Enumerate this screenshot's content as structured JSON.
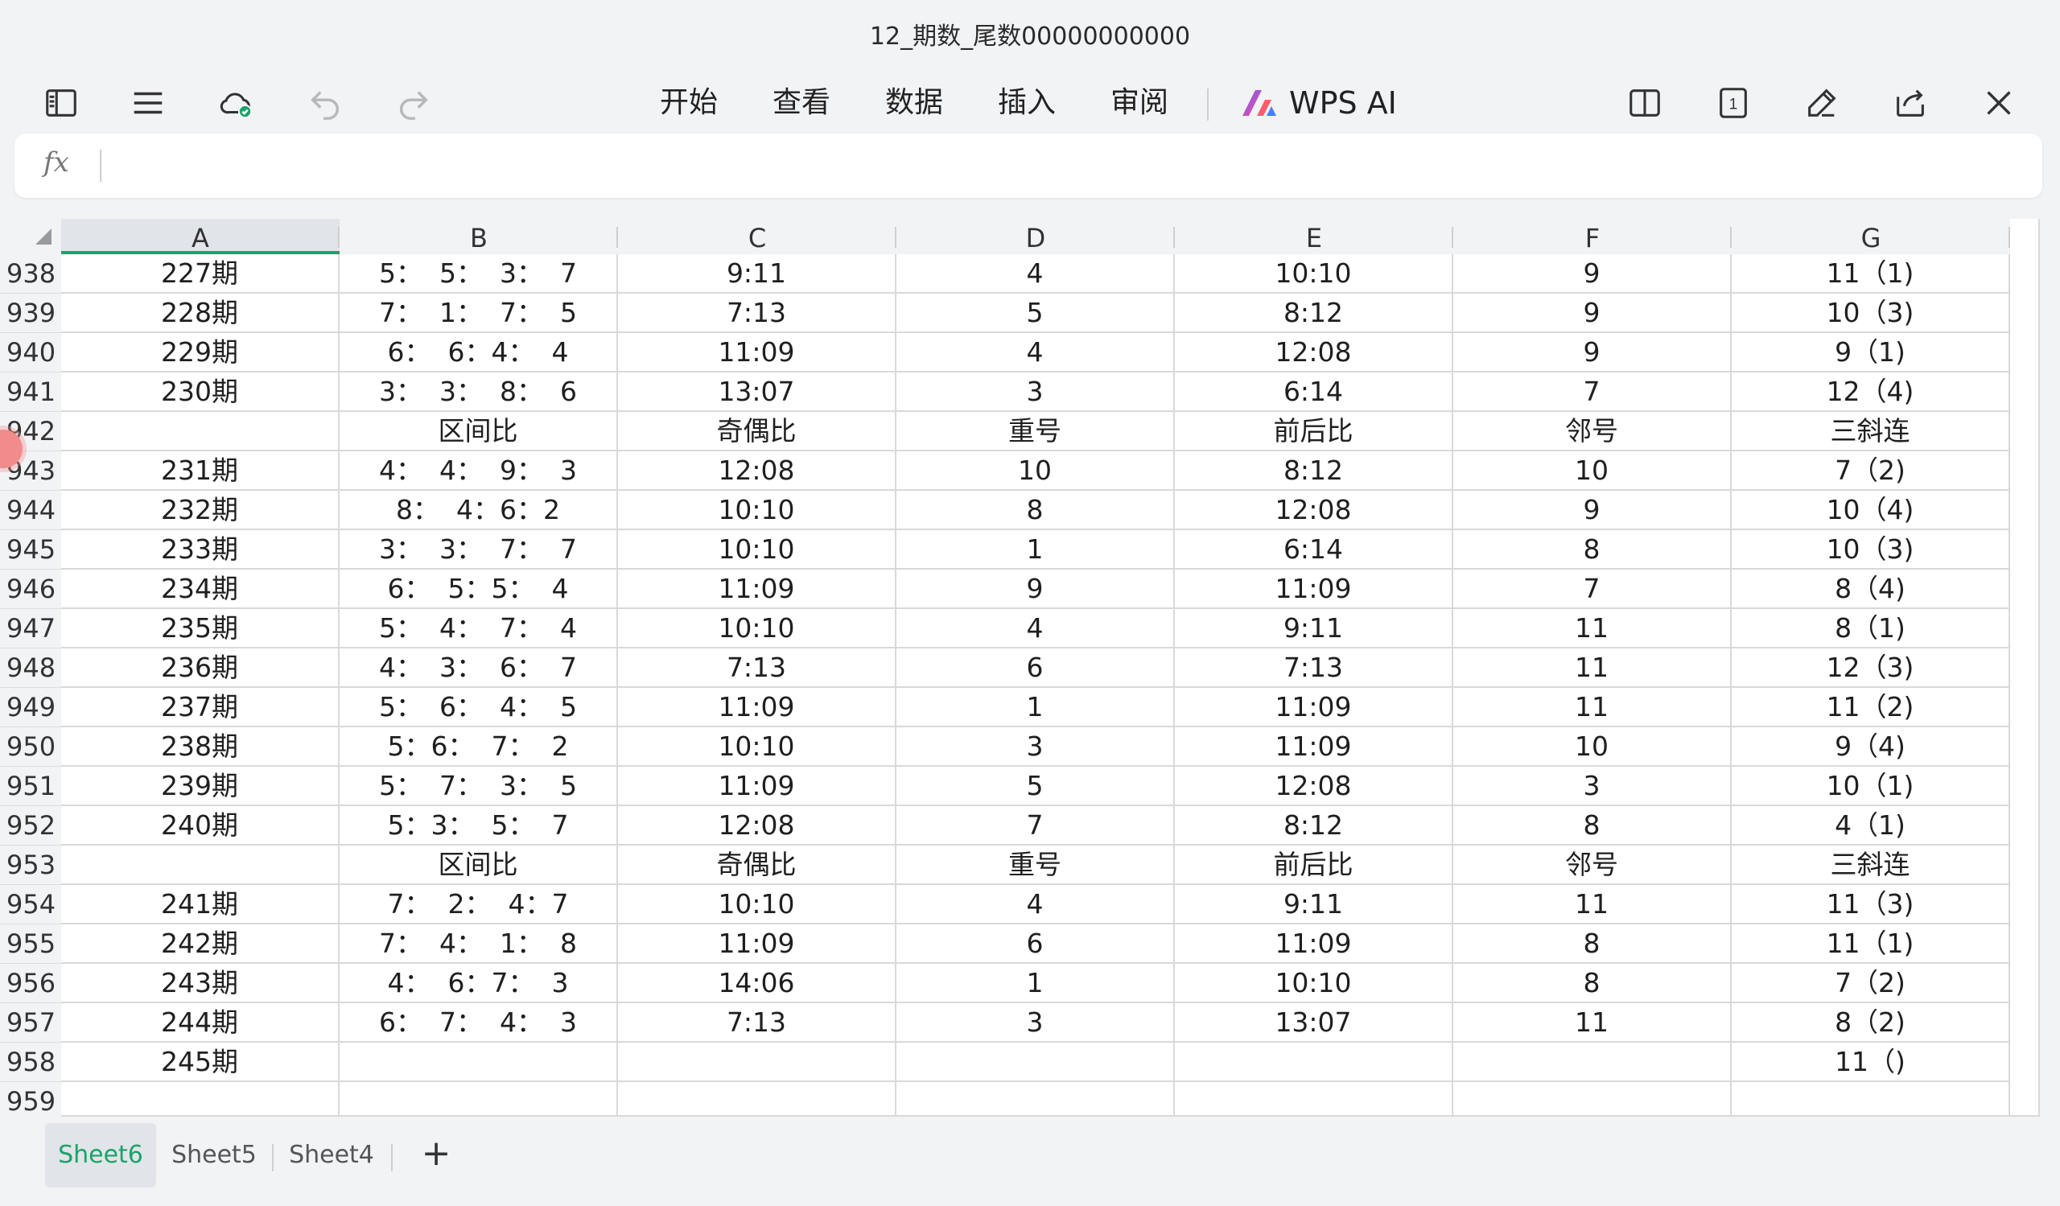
{
  "title": "12_期数_尾数00000000000",
  "toolbar": {
    "menus": [
      "开始",
      "查看",
      "数据",
      "插入",
      "审阅"
    ],
    "ai_label": "WPS AI",
    "page_count": "1"
  },
  "formula_bar": {
    "fx_label": "fx",
    "value": ""
  },
  "columns": [
    "A",
    "B",
    "C",
    "D",
    "E",
    "F",
    "G"
  ],
  "rows": [
    {
      "num": "938",
      "cells": [
        "227期",
        "5：  5：  3：  7",
        "9:11",
        "4",
        "10:10",
        "9",
        "11（1)"
      ]
    },
    {
      "num": "939",
      "cells": [
        "228期",
        "7：  1：  7：  5",
        "7:13",
        "5",
        "8:12",
        "9",
        "10（3)"
      ]
    },
    {
      "num": "940",
      "cells": [
        "229期",
        "6：  6：4：  4",
        "11:09",
        "4",
        "12:08",
        "9",
        "9（1)"
      ]
    },
    {
      "num": "941",
      "cells": [
        "230期",
        "3：  3：  8：  6",
        "13:07",
        "3",
        "6:14",
        "7",
        "12（4)"
      ]
    },
    {
      "num": "942",
      "cells": [
        "",
        "区间比",
        "奇偶比",
        "重号",
        "前后比",
        "邻号",
        "三斜连"
      ]
    },
    {
      "num": "943",
      "cells": [
        "231期",
        "4：  4：  9：  3",
        "12:08",
        "10",
        "8:12",
        "10",
        "7（2)"
      ]
    },
    {
      "num": "944",
      "cells": [
        "232期",
        "8：  4：6：2",
        "10:10",
        "8",
        "12:08",
        "9",
        "10（4)"
      ]
    },
    {
      "num": "945",
      "cells": [
        "233期",
        "3：  3：  7：  7",
        "10:10",
        "1",
        "6:14",
        "8",
        "10（3)"
      ]
    },
    {
      "num": "946",
      "cells": [
        "234期",
        "6：  5：5：  4",
        "11:09",
        "9",
        "11:09",
        "7",
        "8（4)"
      ]
    },
    {
      "num": "947",
      "cells": [
        "235期",
        "5：  4：  7：  4",
        "10:10",
        "4",
        "9:11",
        "11",
        "8（1)"
      ]
    },
    {
      "num": "948",
      "cells": [
        "236期",
        "4：  3：  6：  7",
        "7:13",
        "6",
        "7:13",
        "11",
        "12（3)"
      ]
    },
    {
      "num": "949",
      "cells": [
        "237期",
        "5：  6：  4：  5",
        "11:09",
        "1",
        "11:09",
        "11",
        "11（2)"
      ]
    },
    {
      "num": "950",
      "cells": [
        "238期",
        "5：6：  7：  2",
        "10:10",
        "3",
        "11:09",
        "10",
        "9（4)"
      ]
    },
    {
      "num": "951",
      "cells": [
        "239期",
        "5：  7：  3：  5",
        "11:09",
        "5",
        "12:08",
        "3",
        "10（1)"
      ]
    },
    {
      "num": "952",
      "cells": [
        "240期",
        "5：3：  5：  7",
        "12:08",
        "7",
        "8:12",
        "8",
        "4（1)"
      ]
    },
    {
      "num": "953",
      "cells": [
        "",
        "区间比",
        "奇偶比",
        "重号",
        "前后比",
        "邻号",
        "三斜连"
      ]
    },
    {
      "num": "954",
      "cells": [
        "241期",
        "7：  2：  4：7",
        "10:10",
        "4",
        "9:11",
        "11",
        "11（3)"
      ]
    },
    {
      "num": "955",
      "cells": [
        "242期",
        "7：  4：  1：  8",
        "11:09",
        "6",
        "11:09",
        "8",
        "11（1)"
      ]
    },
    {
      "num": "956",
      "cells": [
        "243期",
        "4：  6：7：  3",
        "14:06",
        "1",
        "10:10",
        "8",
        "7（2)"
      ]
    },
    {
      "num": "957",
      "cells": [
        "244期",
        "6：  7：  4：  3",
        "7:13",
        "3",
        "13:07",
        "11",
        "8（2)"
      ]
    },
    {
      "num": "958",
      "cells": [
        "245期",
        "",
        "",
        "",
        "",
        "",
        "11（)"
      ]
    },
    {
      "num": "959",
      "cells": [
        "",
        "",
        "",
        "",
        "",
        "",
        ""
      ]
    }
  ],
  "sheets": [
    "Sheet6",
    "Sheet5",
    "Sheet4"
  ],
  "add_sheet": "+",
  "colors": {
    "accent": "#1aa36a",
    "header_bg": "#f2f3f5",
    "grid": "#d9d9d9"
  }
}
